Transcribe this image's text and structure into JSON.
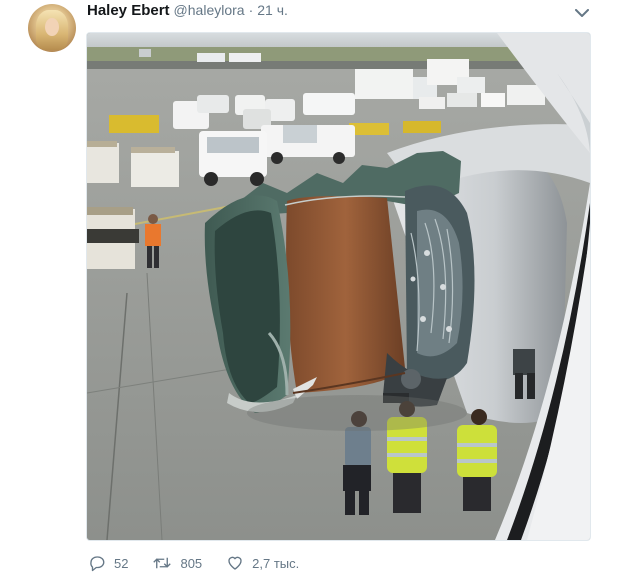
{
  "tweet": {
    "author_name": "Haley Ebert",
    "author_handle": "@haleylora",
    "separator": "·",
    "timestamp": "21 ч."
  },
  "icons": {
    "reply": "reply-icon",
    "retweet": "retweet-icon",
    "like": "like-icon",
    "more": "chevron-down-icon"
  },
  "actions": {
    "replies": "52",
    "retweets": "805",
    "likes": "2,7 тыс."
  },
  "colors": {
    "text_primary": "#14171a",
    "text_secondary": "#657786",
    "border": "#e1e8ed"
  }
}
